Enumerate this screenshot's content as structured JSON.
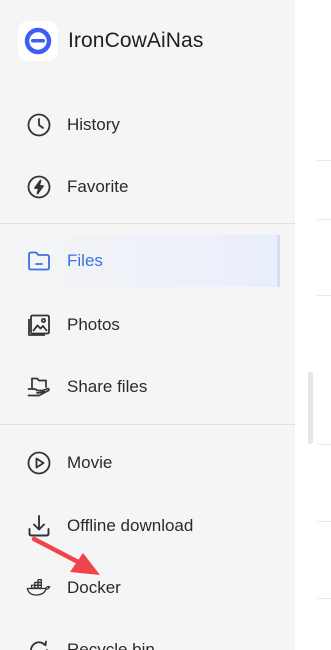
{
  "app": {
    "title": "IronCowAiNas"
  },
  "sidebar": {
    "items": [
      {
        "label": "History",
        "icon": "history-icon"
      },
      {
        "label": "Favorite",
        "icon": "favorite-icon"
      },
      {
        "label": "Files",
        "icon": "folder-icon",
        "active": true
      },
      {
        "label": "Photos",
        "icon": "photos-icon"
      },
      {
        "label": "Share files",
        "icon": "share-files-icon"
      },
      {
        "label": "Movie",
        "icon": "movie-icon"
      },
      {
        "label": "Offline download",
        "icon": "download-icon"
      },
      {
        "label": "Docker",
        "icon": "docker-icon"
      },
      {
        "label": "Recycle bin",
        "icon": "recycle-bin-icon"
      }
    ]
  },
  "colors": {
    "accent": "#3c6fe0",
    "logo": "#3d5df5",
    "annotation_arrow": "#f0434b",
    "sidebar_bg": "#f5f5f5"
  }
}
